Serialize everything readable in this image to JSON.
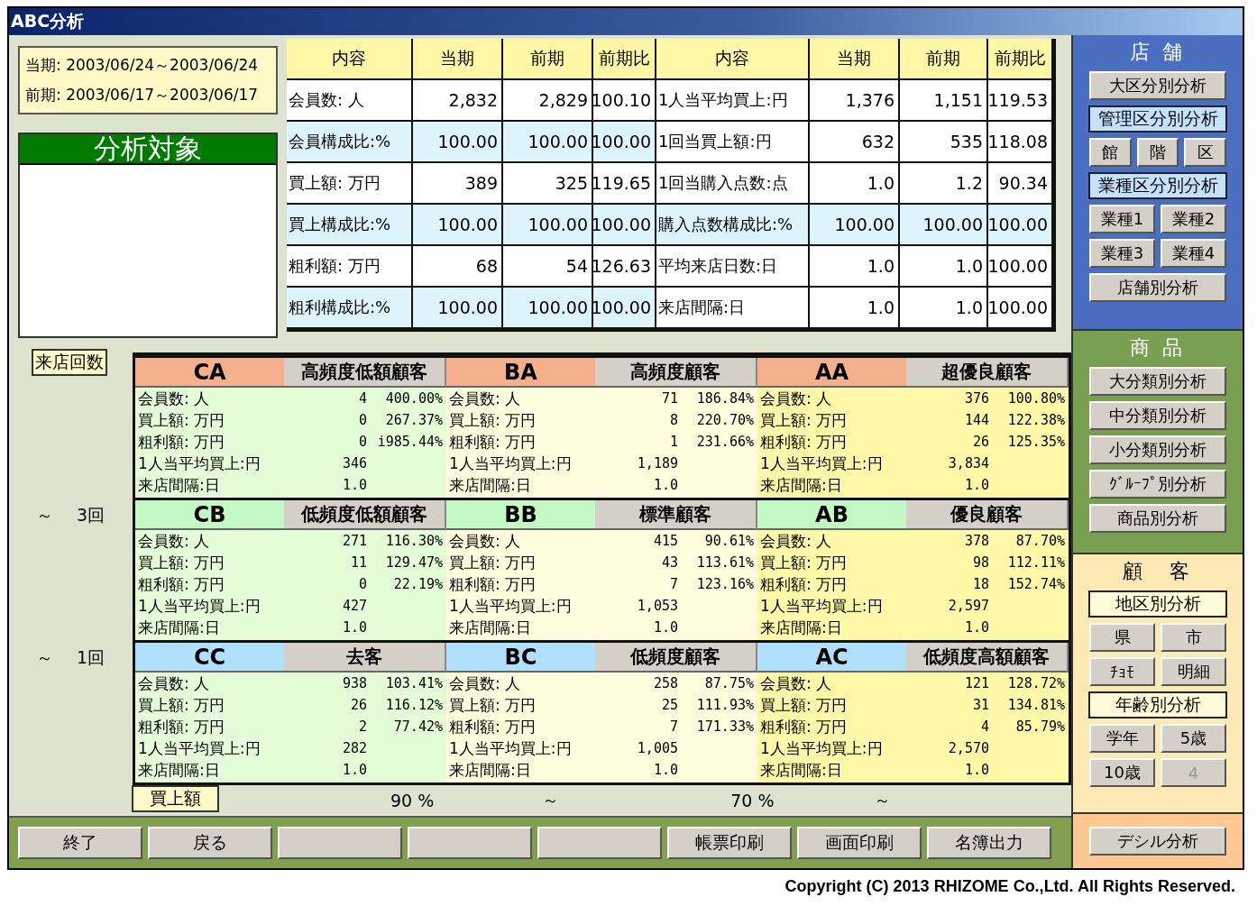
{
  "window": {
    "title": "ABC分析"
  },
  "period": {
    "current": "当期: 2003/06/24～2003/06/24",
    "previous": "前期: 2003/06/17～2003/06/17"
  },
  "target_panel": {
    "title": "分析対象"
  },
  "summary": {
    "columns": [
      "内容",
      "当期",
      "前期",
      "前期比",
      "内容",
      "当期",
      "前期",
      "前期比"
    ],
    "rows": [
      {
        "left": {
          "shaded": false,
          "cells": [
            "会員数: 人",
            "2,832",
            "2,829",
            "100.10"
          ]
        },
        "right": {
          "shaded": false,
          "cells": [
            "1人当平均買上:円",
            "1,376",
            "1,151",
            "119.53"
          ]
        }
      },
      {
        "left": {
          "shaded": true,
          "cells": [
            "会員構成比:%",
            "100.00",
            "100.00",
            "100.00"
          ]
        },
        "right": {
          "shaded": false,
          "cells": [
            "1回当買上額:円",
            "632",
            "535",
            "118.08"
          ]
        }
      },
      {
        "left": {
          "shaded": false,
          "cells": [
            "買上額: 万円",
            "389",
            "325",
            "119.65"
          ]
        },
        "right": {
          "shaded": false,
          "cells": [
            "1回当購入点数:点",
            "1.0",
            "1.2",
            "90.34"
          ]
        }
      },
      {
        "left": {
          "shaded": true,
          "cells": [
            "買上構成比:%",
            "100.00",
            "100.00",
            "100.00"
          ]
        },
        "right": {
          "shaded": true,
          "cells": [
            "購入点数構成比:%",
            "100.00",
            "100.00",
            "100.00"
          ]
        }
      },
      {
        "left": {
          "shaded": false,
          "cells": [
            "粗利額: 万円",
            "68",
            "54",
            "126.63"
          ]
        },
        "right": {
          "shaded": false,
          "cells": [
            "平均来店日数:日",
            "1.0",
            "1.0",
            "100.00"
          ]
        }
      },
      {
        "left": {
          "shaded": true,
          "cells": [
            "粗利構成比:%",
            "100.00",
            "100.00",
            "100.00"
          ]
        },
        "right": {
          "shaded": false,
          "cells": [
            "来店間隔:日",
            "1.0",
            "1.0",
            "100.00"
          ]
        }
      }
    ]
  },
  "matrix": {
    "axis_label": "来店回数",
    "row_labels": [
      {
        "tilde": "～",
        "count": "3回"
      },
      {
        "tilde": "～",
        "count": "1回"
      }
    ],
    "cells": [
      {
        "code": "CA",
        "type": "高頻度低額顧客",
        "color": "#f4b08c",
        "lines": [
          {
            "label": "会員数: 人",
            "value": "4",
            "ratio": "400.00%"
          },
          {
            "label": "買上額: 万円",
            "value": "0",
            "ratio": "267.37%"
          },
          {
            "label": "粗利額: 万円",
            "value": "0",
            "ratio": "i985.44%"
          },
          {
            "label": "1人当平均買上:円",
            "value": "346"
          },
          {
            "label": "来店間隔:日",
            "value": "1.0"
          }
        ]
      },
      {
        "code": "BA",
        "type": "高頻度顧客",
        "color": "#f4b08c",
        "lines": [
          {
            "label": "会員数: 人",
            "value": "71",
            "ratio": "186.84%"
          },
          {
            "label": "買上額: 万円",
            "value": "8",
            "ratio": "220.70%"
          },
          {
            "label": "粗利額: 万円",
            "value": "1",
            "ratio": "231.66%"
          },
          {
            "label": "1人当平均買上:円",
            "value": "1,189"
          },
          {
            "label": "来店間隔:日",
            "value": "1.0"
          }
        ]
      },
      {
        "code": "AA",
        "type": "超優良顧客",
        "color": "#f4b08c",
        "lines": [
          {
            "label": "会員数: 人",
            "value": "376",
            "ratio": "100.80%"
          },
          {
            "label": "買上額: 万円",
            "value": "144",
            "ratio": "122.38%"
          },
          {
            "label": "粗利額: 万円",
            "value": "26",
            "ratio": "125.35%"
          },
          {
            "label": "1人当平均買上:円",
            "value": "3,834"
          },
          {
            "label": "来店間隔:日",
            "value": "1.0"
          }
        ]
      },
      {
        "code": "CB",
        "type": "低頻度低額顧客",
        "color": "#c4f8c4",
        "lines": [
          {
            "label": "会員数: 人",
            "value": "271",
            "ratio": "116.30%"
          },
          {
            "label": "買上額: 万円",
            "value": "11",
            "ratio": "129.47%"
          },
          {
            "label": "粗利額: 万円",
            "value": "0",
            "ratio": "22.19%"
          },
          {
            "label": "1人当平均買上:円",
            "value": "427"
          },
          {
            "label": "来店間隔:日",
            "value": "1.0"
          }
        ]
      },
      {
        "code": "BB",
        "type": "標準顧客",
        "color": "#c4f8c4",
        "lines": [
          {
            "label": "会員数: 人",
            "value": "415",
            "ratio": "90.61%"
          },
          {
            "label": "買上額: 万円",
            "value": "43",
            "ratio": "113.61%"
          },
          {
            "label": "粗利額: 万円",
            "value": "7",
            "ratio": "123.16%"
          },
          {
            "label": "1人当平均買上:円",
            "value": "1,053"
          },
          {
            "label": "来店間隔:日",
            "value": "1.0"
          }
        ]
      },
      {
        "code": "AB",
        "type": "優良顧客",
        "color": "#c4f8c4",
        "lines": [
          {
            "label": "会員数: 人",
            "value": "378",
            "ratio": "87.70%"
          },
          {
            "label": "買上額: 万円",
            "value": "98",
            "ratio": "112.11%"
          },
          {
            "label": "粗利額: 万円",
            "value": "18",
            "ratio": "152.74%"
          },
          {
            "label": "1人当平均買上:円",
            "value": "2,597"
          },
          {
            "label": "来店間隔:日",
            "value": "1.0"
          }
        ]
      },
      {
        "code": "CC",
        "type": "去客",
        "color": "#b0e0fc",
        "lines": [
          {
            "label": "会員数: 人",
            "value": "938",
            "ratio": "103.41%"
          },
          {
            "label": "買上額: 万円",
            "value": "26",
            "ratio": "116.12%"
          },
          {
            "label": "粗利額: 万円",
            "value": "2",
            "ratio": "77.42%"
          },
          {
            "label": "1人当平均買上:円",
            "value": "282"
          },
          {
            "label": "来店間隔:日",
            "value": "1.0"
          }
        ]
      },
      {
        "code": "BC",
        "type": "低頻度顧客",
        "color": "#b0e0fc",
        "lines": [
          {
            "label": "会員数: 人",
            "value": "258",
            "ratio": "87.75%"
          },
          {
            "label": "買上額: 万円",
            "value": "25",
            "ratio": "111.93%"
          },
          {
            "label": "粗利額: 万円",
            "value": "7",
            "ratio": "171.33%"
          },
          {
            "label": "1人当平均買上:円",
            "value": "1,005"
          },
          {
            "label": "来店間隔:日",
            "value": "1.0"
          }
        ]
      },
      {
        "code": "AC",
        "type": "低頻度高額顧客",
        "color": "#b0e0fc",
        "lines": [
          {
            "label": "会員数: 人",
            "value": "121",
            "ratio": "128.72%"
          },
          {
            "label": "買上額: 万円",
            "value": "31",
            "ratio": "134.81%"
          },
          {
            "label": "粗利額: 万円",
            "value": "4",
            "ratio": "85.79%"
          },
          {
            "label": "1人当平均買上:円",
            "value": "2,570"
          },
          {
            "label": "来店間隔:日",
            "value": "1.0"
          }
        ]
      }
    ],
    "x_axis": {
      "label": "買上額",
      "marks": [
        "90 %",
        "～",
        "70 %",
        "～"
      ]
    }
  },
  "side_panel": [
    {
      "kind": "store",
      "title": "店 舗",
      "items": [
        {
          "kind": "button",
          "buttons": [
            {
              "label": "大区分別分析",
              "disabled": false
            }
          ]
        },
        {
          "kind": "heading",
          "label": "管理区分別分析"
        },
        {
          "kind": "button",
          "buttons": [
            {
              "label": "館",
              "disabled": false
            },
            {
              "label": "階",
              "disabled": false
            },
            {
              "label": "区",
              "disabled": false
            }
          ]
        },
        {
          "kind": "heading",
          "label": "業種区分別分析"
        },
        {
          "kind": "button",
          "buttons": [
            {
              "label": "業種1",
              "disabled": false
            },
            {
              "label": "業種2",
              "disabled": false
            }
          ]
        },
        {
          "kind": "button",
          "buttons": [
            {
              "label": "業種3",
              "disabled": false
            },
            {
              "label": "業種4",
              "disabled": false
            }
          ]
        },
        {
          "kind": "button",
          "buttons": [
            {
              "label": "店舗別分析",
              "disabled": false
            }
          ]
        }
      ]
    },
    {
      "kind": "product",
      "title": "商 品",
      "items": [
        {
          "kind": "button",
          "buttons": [
            {
              "label": "大分類別分析",
              "disabled": false
            }
          ]
        },
        {
          "kind": "button",
          "buttons": [
            {
              "label": "中分類別分析",
              "disabled": false
            }
          ]
        },
        {
          "kind": "button",
          "buttons": [
            {
              "label": "小分類別分析",
              "disabled": false
            }
          ]
        },
        {
          "kind": "button",
          "buttons": [
            {
              "label": "ｸﾞﾙｰﾌﾟ別分析",
              "disabled": false
            }
          ]
        },
        {
          "kind": "button",
          "buttons": [
            {
              "label": "商品別分析",
              "disabled": false
            }
          ]
        }
      ]
    },
    {
      "kind": "customer",
      "title": "顧　客",
      "items": [
        {
          "kind": "heading",
          "label": "地区別分析"
        },
        {
          "kind": "button",
          "buttons": [
            {
              "label": "県",
              "disabled": false
            },
            {
              "label": "市",
              "disabled": false
            }
          ]
        },
        {
          "kind": "button",
          "buttons": [
            {
              "label": "ﾁｮﾓ",
              "disabled": false
            },
            {
              "label": "明細",
              "disabled": false
            }
          ]
        },
        {
          "kind": "heading",
          "label": "年齢別分析"
        },
        {
          "kind": "button",
          "buttons": [
            {
              "label": "学年",
              "disabled": false
            },
            {
              "label": "5歳",
              "disabled": false
            }
          ]
        },
        {
          "kind": "button",
          "buttons": [
            {
              "label": "10歳",
              "disabled": false
            },
            {
              "label": "4",
              "disabled": true
            }
          ]
        }
      ]
    },
    {
      "kind": "decile",
      "items": [
        {
          "kind": "button",
          "buttons": [
            {
              "label": "デシル分析",
              "disabled": false
            }
          ]
        }
      ]
    }
  ],
  "footer": [
    {
      "kind": "button",
      "label": "終了"
    },
    {
      "kind": "button",
      "label": "戻る"
    },
    {
      "kind": "blank"
    },
    {
      "kind": "blank"
    },
    {
      "kind": "blank"
    },
    {
      "kind": "button",
      "label": "帳票印刷"
    },
    {
      "kind": "button",
      "label": "画面印刷"
    },
    {
      "kind": "button",
      "label": "名簿出力"
    }
  ],
  "copyright": "Copyright (C) 2013 RHIZOME Co.,Ltd. All Rights Reserved."
}
